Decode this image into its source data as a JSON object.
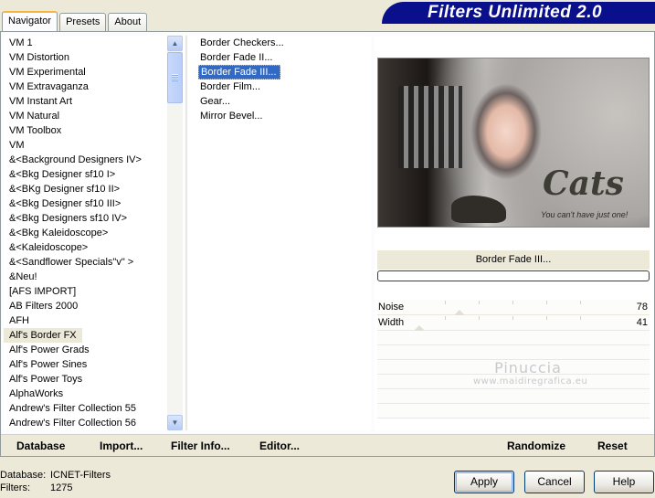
{
  "tabs": [
    "Navigator",
    "Presets",
    "About"
  ],
  "banner": "Filters Unlimited 2.0",
  "categories": [
    "VM 1",
    "VM Distortion",
    "VM Experimental",
    "VM Extravaganza",
    "VM Instant Art",
    "VM Natural",
    "VM Toolbox",
    "VM",
    "&<Background Designers IV>",
    "&<Bkg Designer sf10 I>",
    "&<BKg Designer sf10 II>",
    "&<Bkg Designer sf10 III>",
    "&<Bkg Designers sf10 IV>",
    "&<Bkg Kaleidoscope>",
    "&<Kaleidoscope>",
    "&<Sandflower Specials\"v\" >",
    "&Neu!",
    "[AFS IMPORT]",
    "AB Filters 2000",
    "AFH",
    "Alf's Border FX",
    "Alf's Power Grads",
    "Alf's Power Sines",
    "Alf's Power Toys",
    "AlphaWorks",
    "Andrew's Filter Collection 55",
    "Andrew's Filter Collection 56"
  ],
  "selected_category": "Alf's Border FX",
  "effects": [
    "Border Checkers...",
    "Border Fade II...",
    "Border Fade III...",
    "Border Film...",
    "Gear...",
    "Mirror Bevel..."
  ],
  "selected_effect": "Border Fade III...",
  "preview": {
    "title": "Cats",
    "subtitle": "You can't have just one!"
  },
  "effect_name": "Border Fade III...",
  "params": [
    {
      "label": "Noise",
      "value": "78",
      "level": 0.3
    },
    {
      "label": "Width",
      "value": "41",
      "level": 0.16
    }
  ],
  "watermark": {
    "line1": "Pinuccia",
    "line2": "www.maidiregrafica.eu"
  },
  "bottom_buttons": {
    "database": "Database",
    "import": "Import...",
    "filter_info": "Filter Info...",
    "editor": "Editor...",
    "randomize": "Randomize",
    "reset": "Reset"
  },
  "status": {
    "database_label": "Database:",
    "database_value": "ICNET-Filters",
    "filters_label": "Filters:",
    "filters_value": "1275"
  },
  "dialog_buttons": {
    "apply": "Apply",
    "cancel": "Cancel",
    "help": "Help"
  }
}
